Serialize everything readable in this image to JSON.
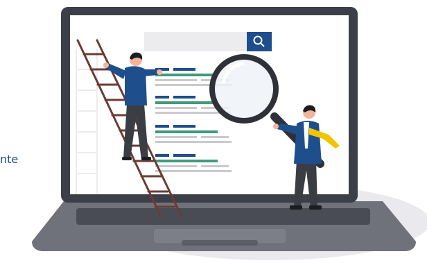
{
  "partial_text": "nte",
  "colors": {
    "laptop_frame": "#3d3f48",
    "laptop_base": "#6f727b",
    "screen": "#ffffff",
    "search_bar": "#ececef",
    "search_button": "#1f4e8c",
    "result_blue": "#1f4e8c",
    "result_green": "#3f9b78",
    "result_gray": "#c9cacd",
    "ladder": "#6b3b34",
    "shirt": "#1f4e8c",
    "pants": "#3b3d44",
    "tie": "#f2c400",
    "shadow": "#e9e9ee"
  },
  "icons": [
    "search-icon",
    "magnifying-glass-icon"
  ]
}
